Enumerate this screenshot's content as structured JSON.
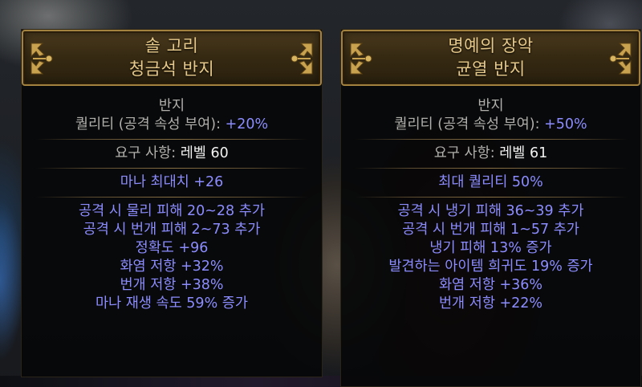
{
  "left_item": {
    "name": "솔 고리",
    "base": "청금석 반지",
    "item_class": "반지",
    "quality_label": "퀄리티 (공격 속성 부여): ",
    "quality_value": "+20%",
    "requirement_label": "요구 사항: ",
    "requirement_value": "레벨 60",
    "implicit": "마나 최대치 +26",
    "mods": [
      "공격 시 물리 피해 20~28 추가",
      "공격 시 번개 피해 2~73 추가",
      "정확도 +96",
      "화염 저항 +32%",
      "번개 저항 +38%",
      "마나 재생 속도 59% 증가"
    ]
  },
  "right_item": {
    "name": "명예의 장악",
    "base": "균열 반지",
    "item_class": "반지",
    "quality_label": "퀄리티 (공격 속성 부여): ",
    "quality_value": "+50%",
    "requirement_label": "요구 사항: ",
    "requirement_value": "레벨 61",
    "implicit": "최대 퀄리티 50%",
    "mods": [
      "공격 시 냉기 피해 36~39 추가",
      "공격 시 번개 피해 1~57 추가",
      "냉기 피해 13% 증가",
      "발견하는 아이템 희귀도 19% 증가",
      "화염 저항 +36%",
      "번개 저항 +22%"
    ]
  },
  "colors": {
    "header_text": "#e6c98a",
    "magic_mod": "#8c8cff",
    "label_grey": "#b0afab",
    "value_white": "#f2f2f2",
    "frame_gold": "#a3813f"
  },
  "icons": [
    "gold-corner-ornament-icon"
  ]
}
